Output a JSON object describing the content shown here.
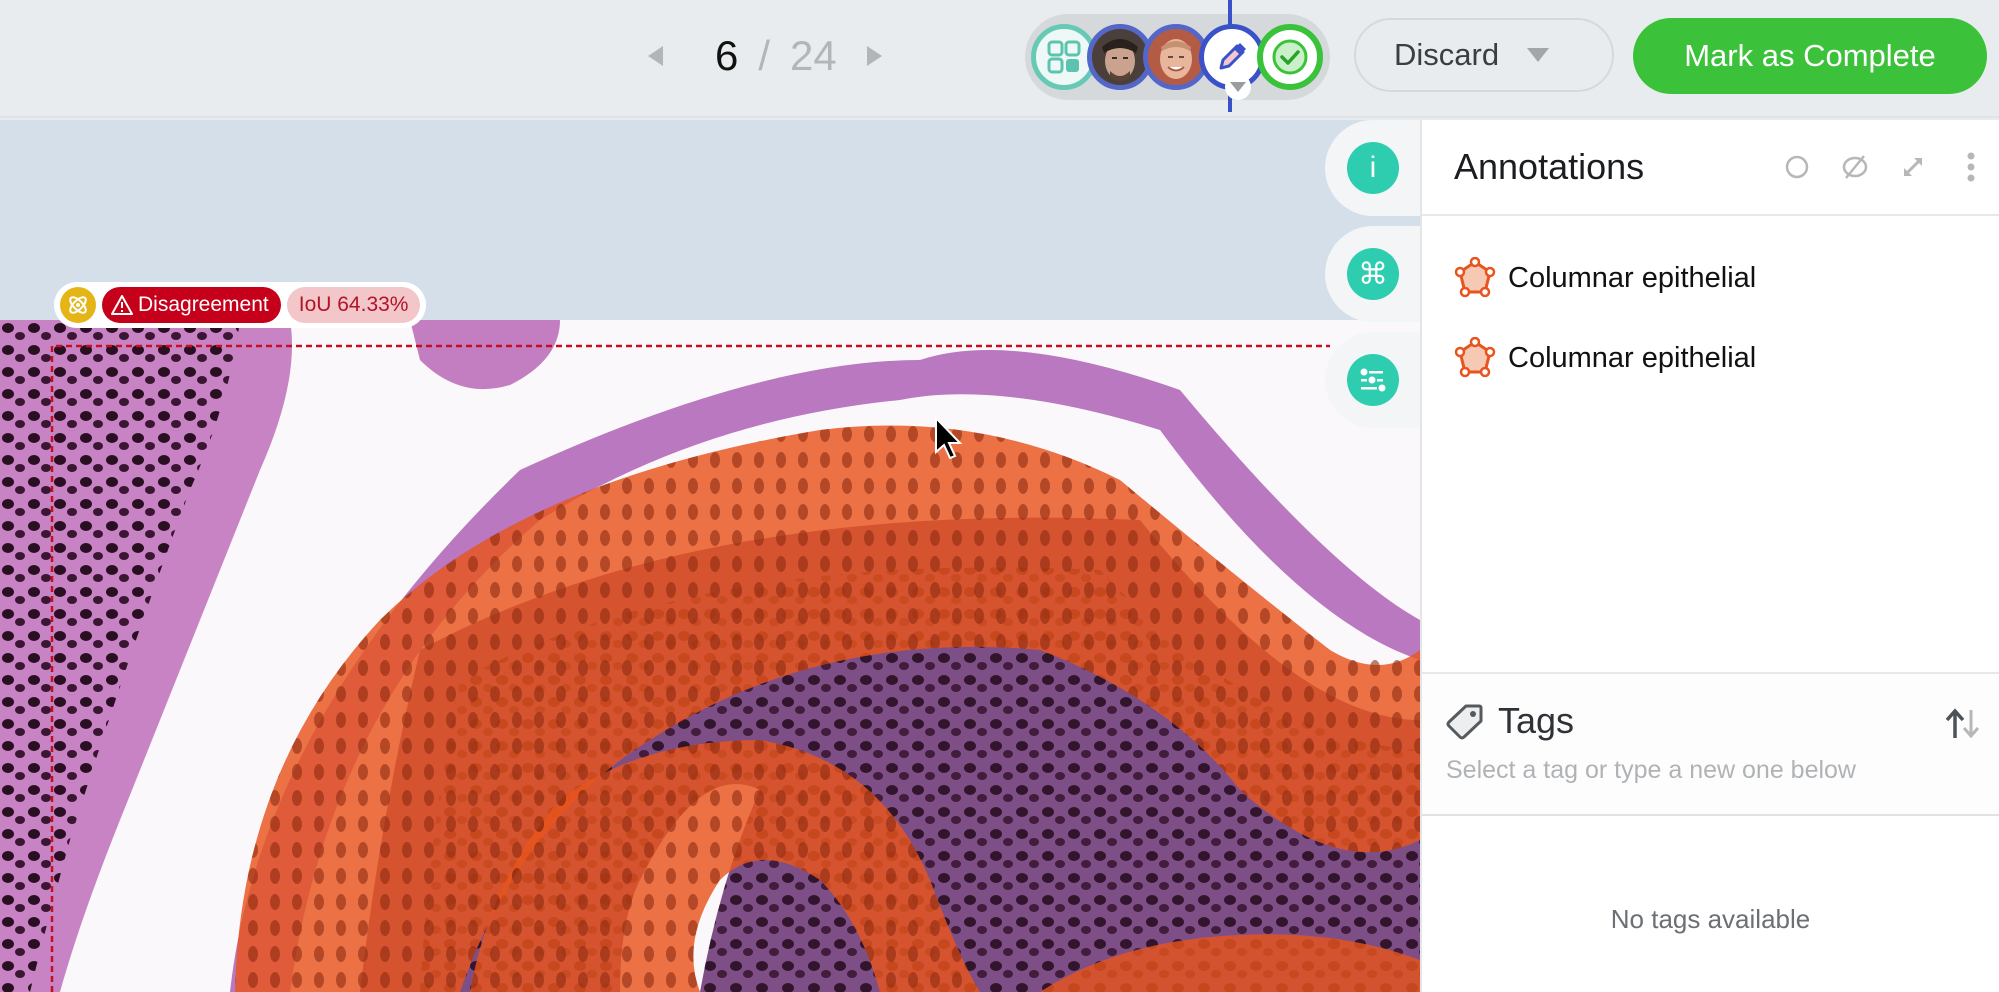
{
  "pager": {
    "current": "6",
    "separator": "/",
    "total": "24"
  },
  "stages": [
    {
      "name": "overview",
      "icon": "grid-icon"
    },
    {
      "name": "annotator-1",
      "icon": "avatar"
    },
    {
      "name": "annotator-2",
      "icon": "avatar"
    },
    {
      "name": "edit",
      "icon": "pencil-icon",
      "active": true
    },
    {
      "name": "complete",
      "icon": "check-circle-icon"
    }
  ],
  "actions": {
    "discard_label": "Discard",
    "complete_label": "Mark as Complete"
  },
  "canvas": {
    "badges": {
      "consensus_icon": "atom-icon",
      "disagreement_label": "Disagreement",
      "iou_label": "IoU 64.33%"
    }
  },
  "side_tools": [
    {
      "name": "info",
      "glyph": "i"
    },
    {
      "name": "shortcuts",
      "glyph": "⌘"
    },
    {
      "name": "settings",
      "glyph": "sliders"
    }
  ],
  "annotations": {
    "title": "Annotations",
    "items": [
      {
        "label": "Columnar epithelial",
        "icon": "polygon-icon",
        "color": "#e8541c"
      },
      {
        "label": "Columnar epithelial",
        "icon": "polygon-icon",
        "color": "#e8541c"
      }
    ]
  },
  "tags": {
    "title": "Tags",
    "placeholder": "Select a tag or type a new one below",
    "empty_text": "No tags available"
  },
  "colors": {
    "accent_teal": "#2ecdaf",
    "complete_green": "#3cc13a",
    "disagreement_red": "#c6001a",
    "annotation_orange": "#e8541c"
  }
}
